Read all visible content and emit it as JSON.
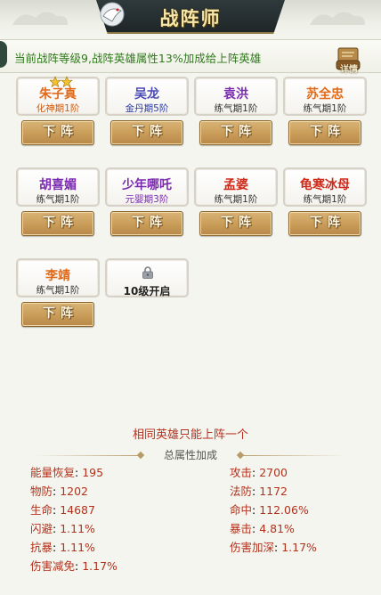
{
  "window": {
    "title": "战阵师"
  },
  "info": {
    "message": "当前战阵等级9,战阵英雄属性13%加成给上阵英雄",
    "detail_label": "详情"
  },
  "colors": {
    "legend": "#e06a1a",
    "gold": "#3a56b8",
    "green": "#6a2ab0",
    "red": "#d02a1a",
    "level": "#333333",
    "level_orange": "#d05a10",
    "button_text": "#fff8e4"
  },
  "slots": [
    {
      "name": "朱子真",
      "level": "化神期1阶",
      "name_color": "#e06a1a",
      "level_color": "#d05a10",
      "starred": true
    },
    {
      "name": "吴龙",
      "level": "金丹期5阶",
      "name_color": "#4a4ab8",
      "level_color": "#2a3aa8",
      "starred": false
    },
    {
      "name": "袁洪",
      "level": "练气期1阶",
      "name_color": "#7a2ab0",
      "level_color": "#333333",
      "starred": false
    },
    {
      "name": "苏全忠",
      "level": "练气期1阶",
      "name_color": "#e06a1a",
      "level_color": "#333333",
      "starred": false
    },
    {
      "name": "胡喜媚",
      "level": "练气期1阶",
      "name_color": "#7a2ab0",
      "level_color": "#333333",
      "starred": false
    },
    {
      "name": "少年哪吒",
      "level": "元婴期3阶",
      "name_color": "#7a2ab0",
      "level_color": "#7a2ab0",
      "starred": false
    },
    {
      "name": "孟婆",
      "level": "练气期1阶",
      "name_color": "#d02a1a",
      "level_color": "#333333",
      "starred": false
    },
    {
      "name": "龟寒冰母",
      "level": "练气期1阶",
      "name_color": "#d02a1a",
      "level_color": "#333333",
      "starred": false
    },
    {
      "name": "李靖",
      "level": "练气期1阶",
      "name_color": "#e06a1a",
      "level_color": "#333333",
      "starred": false
    }
  ],
  "locked_slot": {
    "unlock_text": "10级开启",
    "icon": "lock-icon"
  },
  "buttons": {
    "remove_label": "下阵"
  },
  "notice": "相同英雄只能上阵一个",
  "stats_title": "总属性加成",
  "stats": {
    "left": [
      {
        "key": "能量恢复",
        "value": "195"
      },
      {
        "key": "物防",
        "value": "1202"
      },
      {
        "key": "生命",
        "value": "14687"
      },
      {
        "key": "闪避",
        "value": "1.11%"
      },
      {
        "key": "抗暴",
        "value": "1.11%"
      },
      {
        "key": "伤害减免",
        "value": "1.17%"
      }
    ],
    "right": [
      {
        "key": "攻击",
        "value": "2700"
      },
      {
        "key": "法防",
        "value": "1172"
      },
      {
        "key": "命中",
        "value": "112.06%"
      },
      {
        "key": "暴击",
        "value": "4.81%"
      },
      {
        "key": "伤害加深",
        "value": "1.17%"
      }
    ]
  }
}
